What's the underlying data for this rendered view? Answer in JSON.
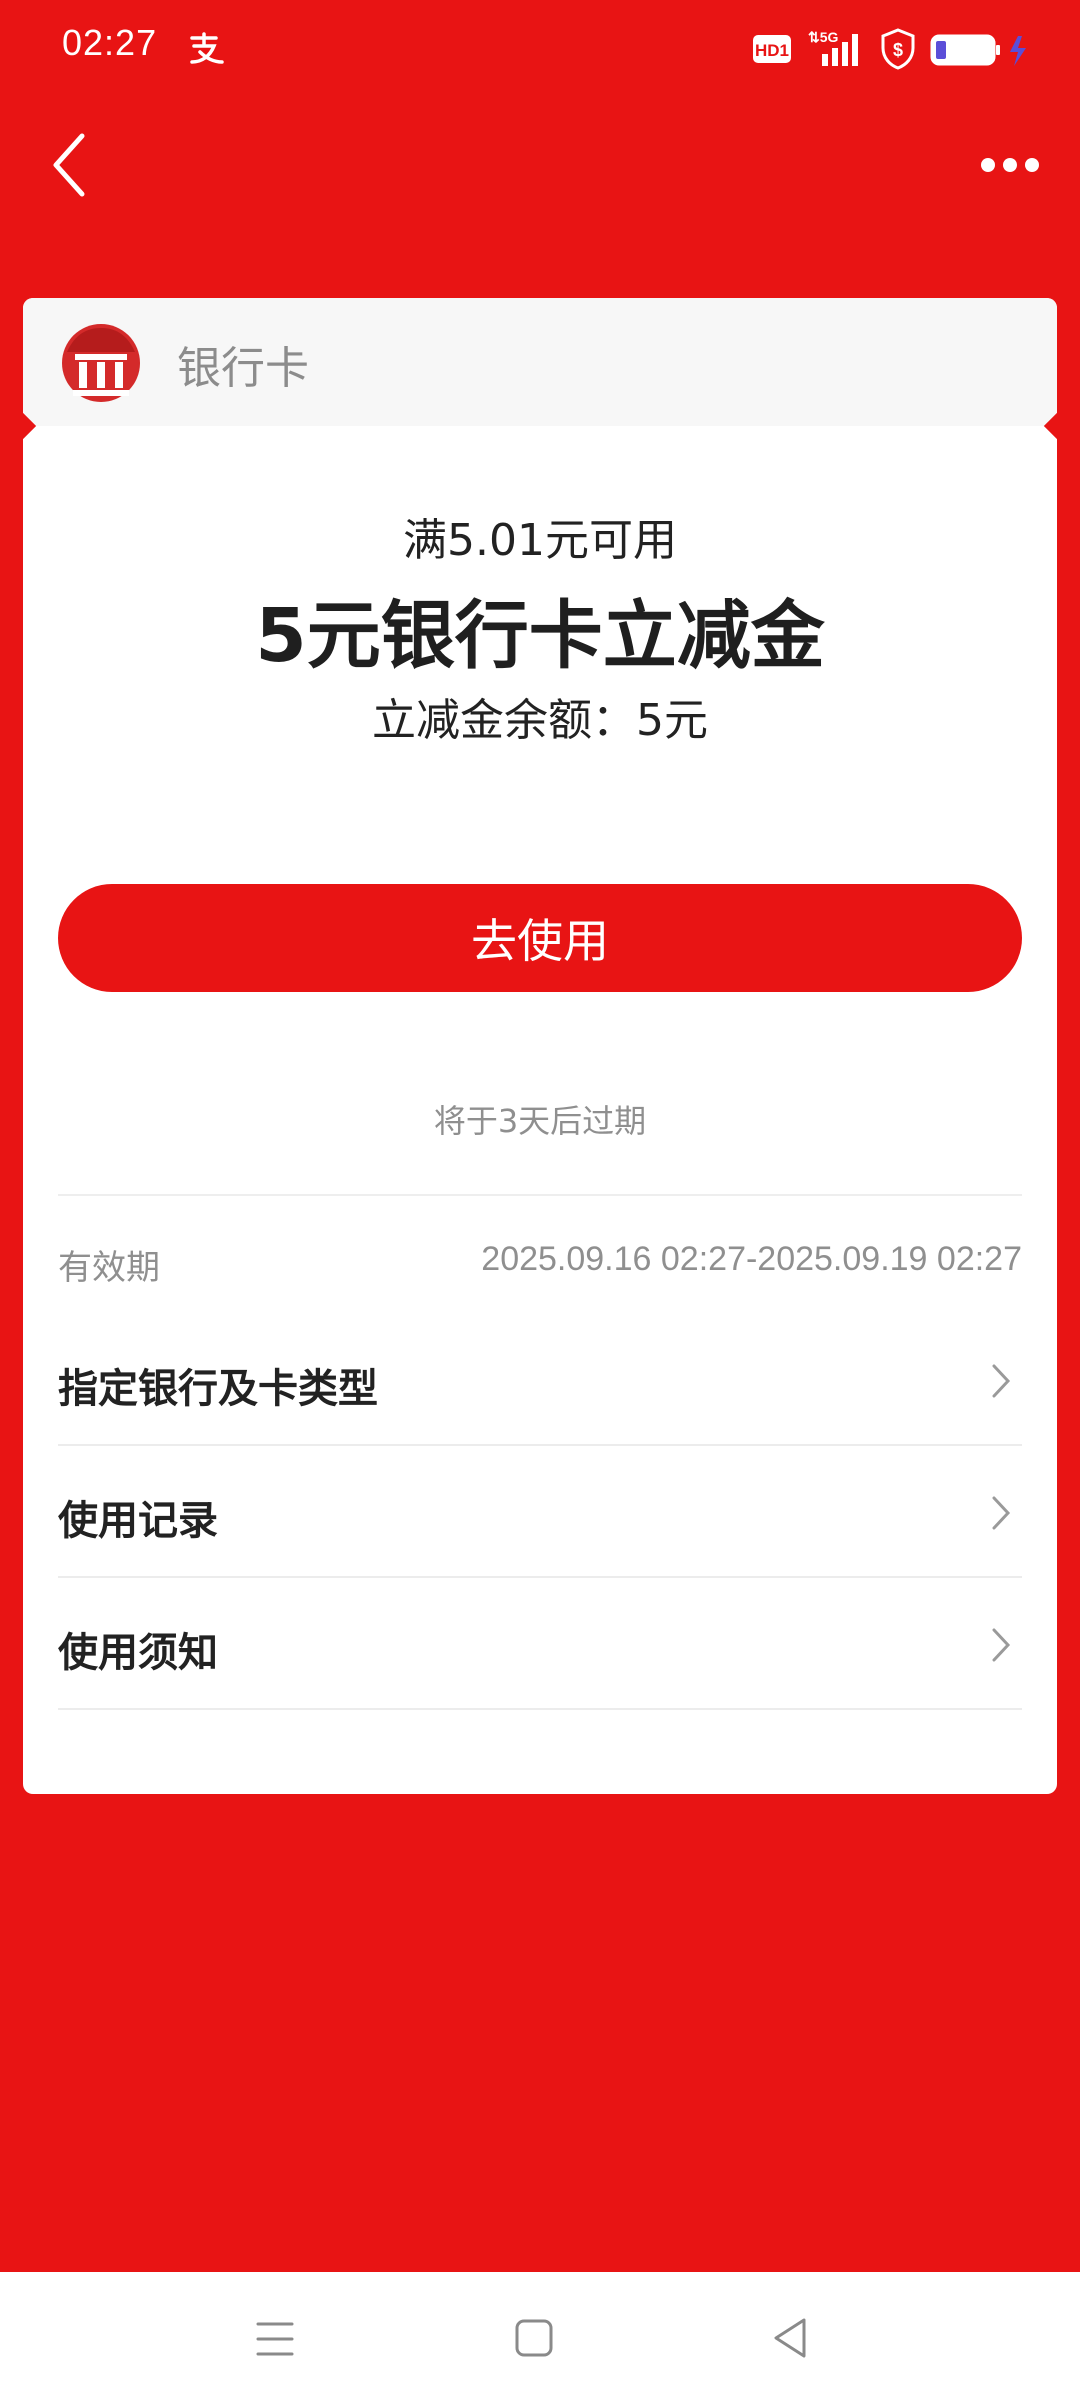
{
  "status_bar": {
    "time": "02:27",
    "icons": [
      "alipay-icon",
      "hd-icon",
      "5g-signal-icon",
      "shield-icon",
      "battery-icon",
      "charging-icon"
    ]
  },
  "nav": {
    "back_icon": "back-arrow-icon",
    "more_icon": "more-icon"
  },
  "card": {
    "header": {
      "logo_icon": "bank-icon",
      "type_label": "银行卡"
    },
    "condition": "满5.01元可用",
    "title": "5元银行卡立减金",
    "balance": "立减金余额：5元",
    "use_button": "去使用",
    "expire_hint": "将于3天后过期",
    "validity": {
      "label": "有效期",
      "value": "2025.09.16 02:27-2025.09.19 02:27"
    },
    "rows": [
      {
        "label": "指定银行及卡类型"
      },
      {
        "label": "使用记录"
      },
      {
        "label": "使用须知"
      }
    ]
  },
  "colors": {
    "brand_red": "#e81414",
    "text_gray": "#8f8f8f"
  }
}
